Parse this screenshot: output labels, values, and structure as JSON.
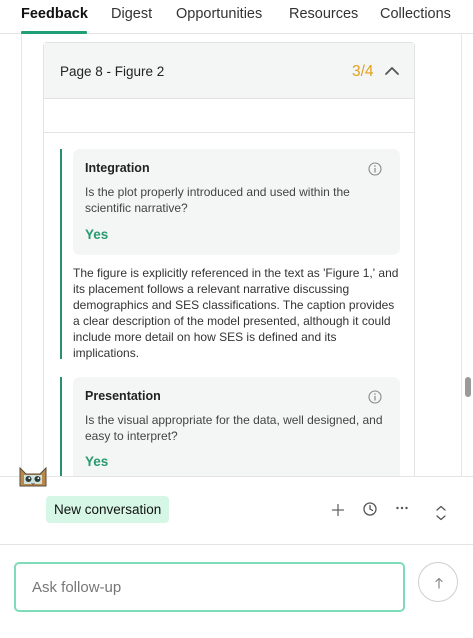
{
  "tabs": [
    {
      "label": "Feedback",
      "active": true
    },
    {
      "label": "Digest"
    },
    {
      "label": "Opportunities"
    },
    {
      "label": "Resources"
    },
    {
      "label": "Collections"
    }
  ],
  "figure": {
    "title": "Page 8 - Figure 2",
    "score": "3/4",
    "criteria": [
      {
        "title": "Integration",
        "question": "Is the plot properly introduced and used within the scientific narrative?",
        "answer": "Yes",
        "explanation": "The figure is explicitly referenced in the text as 'Figure 1,' and its placement follows a relevant narrative discussing demographics and SES classifications. The caption provides a clear description of the model presented, although it could include more detail on how SES is defined and its implications."
      },
      {
        "title": "Presentation",
        "question": "Is the visual appropriate for the data, well designed, and easy to interpret?",
        "answer": "Yes"
      }
    ]
  },
  "chat": {
    "new_conversation": "New conversation",
    "ask_placeholder": "Ask follow-up"
  },
  "colors": {
    "accent": "#1f9e77",
    "score": "#e0a020",
    "answer": "#2a9a70",
    "pill_bg": "#d6f6e6",
    "input_border": "#7fdcb8"
  },
  "icons": [
    "chevron-up-icon",
    "info-icon",
    "plus-icon",
    "history-icon",
    "more-icon",
    "expand-icon",
    "send-arrow-icon",
    "cat-mascot-icon"
  ]
}
